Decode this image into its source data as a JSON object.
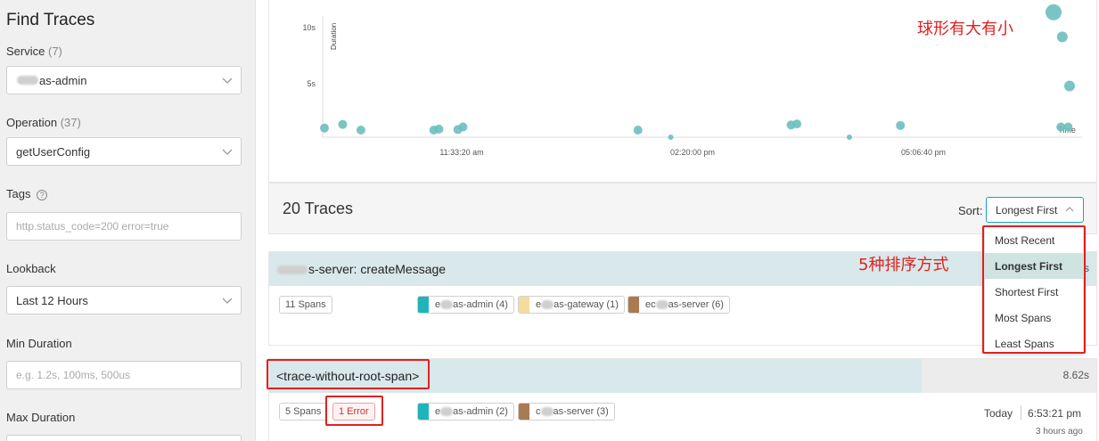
{
  "sidebar": {
    "title": "Find Traces",
    "service": {
      "label": "Service",
      "count": "(7)",
      "value_suffix": "as-admin"
    },
    "operation": {
      "label": "Operation",
      "count": "(37)",
      "value": "getUserConfig"
    },
    "tags": {
      "label": "Tags",
      "help": "?",
      "placeholder": "http.status_code=200 error=true"
    },
    "lookback": {
      "label": "Lookback",
      "value": "Last 12 Hours"
    },
    "min_duration": {
      "label": "Min Duration",
      "placeholder": "e.g. 1.2s, 100ms, 500us"
    },
    "max_duration": {
      "label": "Max Duration"
    }
  },
  "chart_data": {
    "type": "scatter",
    "ylabel": "Duration",
    "xlabel": "Time",
    "y_ticks": [
      "10s",
      "5s"
    ],
    "x_ticks": [
      "11:33:20 am",
      "02:20:00 pm",
      "05:06:40 pm"
    ],
    "points": [
      {
        "x": 0.0,
        "y": 0.2,
        "r": 5
      },
      {
        "x": 0.025,
        "y": 0.55,
        "r": 5
      },
      {
        "x": 0.05,
        "y": 0.0,
        "r": 5
      },
      {
        "x": 0.15,
        "y": 0.0,
        "r": 5
      },
      {
        "x": 0.157,
        "y": 0.1,
        "r": 5
      },
      {
        "x": 0.183,
        "y": 0.05,
        "r": 5
      },
      {
        "x": 0.19,
        "y": 0.3,
        "r": 5
      },
      {
        "x": 0.43,
        "y": 0.0,
        "r": 5
      },
      {
        "x": 0.475,
        "y": -0.7,
        "r": 3
      },
      {
        "x": 0.64,
        "y": 0.5,
        "r": 5
      },
      {
        "x": 0.648,
        "y": 0.6,
        "r": 5
      },
      {
        "x": 0.72,
        "y": -0.7,
        "r": 3
      },
      {
        "x": 0.79,
        "y": 0.45,
        "r": 5
      },
      {
        "x": 1.0,
        "y": 11.5,
        "r": 9
      },
      {
        "x": 1.012,
        "y": 9.1,
        "r": 6
      },
      {
        "x": 1.022,
        "y": 4.3,
        "r": 6
      },
      {
        "x": 1.01,
        "y": 0.3,
        "r": 5
      },
      {
        "x": 1.02,
        "y": 0.3,
        "r": 5
      }
    ],
    "color": "#6cbfbd"
  },
  "chart_annotation": "球形有大有小",
  "traces": {
    "count_label": "20 Traces",
    "sort_label": "Sort:",
    "sort_value": "Longest First",
    "sort_options": [
      "Most Recent",
      "Longest First",
      "Shortest First",
      "Most Spans",
      "Least Spans"
    ],
    "sort_annotation": "5种排序方式",
    "items": [
      {
        "title_suffix": "s-server: createMessage",
        "duration_fragment": "s",
        "spans": "11 Spans",
        "services": [
          {
            "label_prefix": "e",
            "label_suffix": "as-admin (4)",
            "color": "#1fb4b9"
          },
          {
            "label_prefix": "e",
            "label_suffix": "as-gateway (1)",
            "color": "#f6dba1"
          },
          {
            "label_prefix": "ec",
            "label_suffix": "as-server (6)",
            "color": "#a97b50"
          }
        ]
      },
      {
        "title": "<trace-without-root-span>",
        "duration": "8.62s",
        "spans": "5 Spans",
        "error": "1 Error",
        "services": [
          {
            "label_prefix": "e",
            "label_suffix": "as-admin (2)",
            "color": "#1fb4b9"
          },
          {
            "label_prefix": "c",
            "label_suffix": "as-server (3)",
            "color": "#a97b50"
          }
        ],
        "date": "Today",
        "time": "6:53:21 pm",
        "ago": "3 hours ago"
      }
    ]
  },
  "colors": {
    "accent": "#1aa6b7",
    "annotation": "#e02020"
  }
}
